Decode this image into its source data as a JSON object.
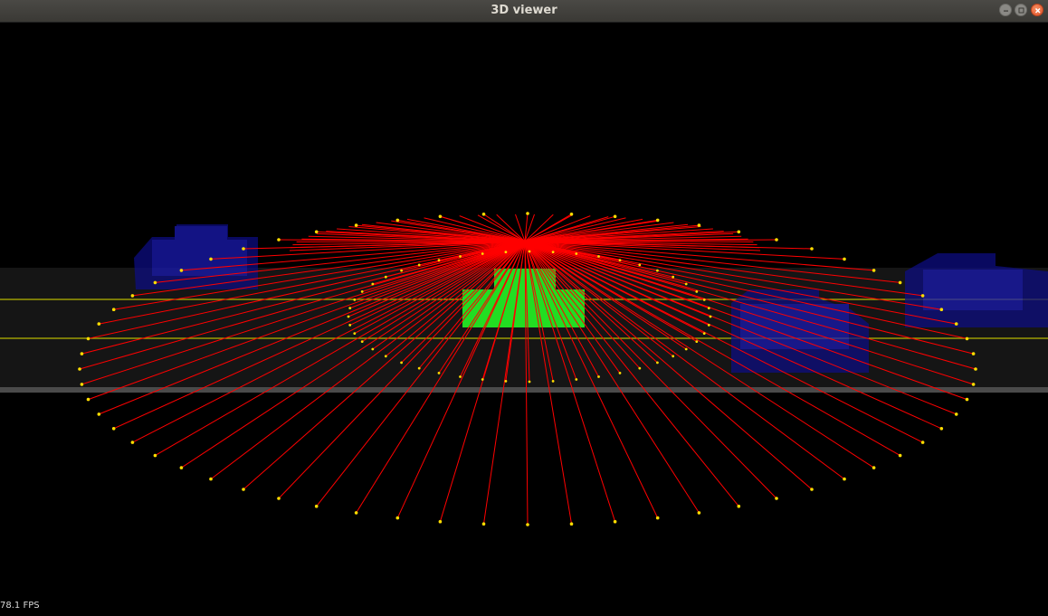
{
  "window": {
    "title": "3D viewer",
    "controls": [
      "minimize",
      "maximize",
      "close"
    ]
  },
  "scene": {
    "background_color": "#000000",
    "ray_color": "#ff0000",
    "point_color": "#ffdd00",
    "ego_vehicle_color": "#22dd22",
    "obstacle_color": "#1515a0",
    "lane_line_color": "#b8b800",
    "road_color": "#151515"
  },
  "status": {
    "fps_text": "78.1 FPS"
  }
}
